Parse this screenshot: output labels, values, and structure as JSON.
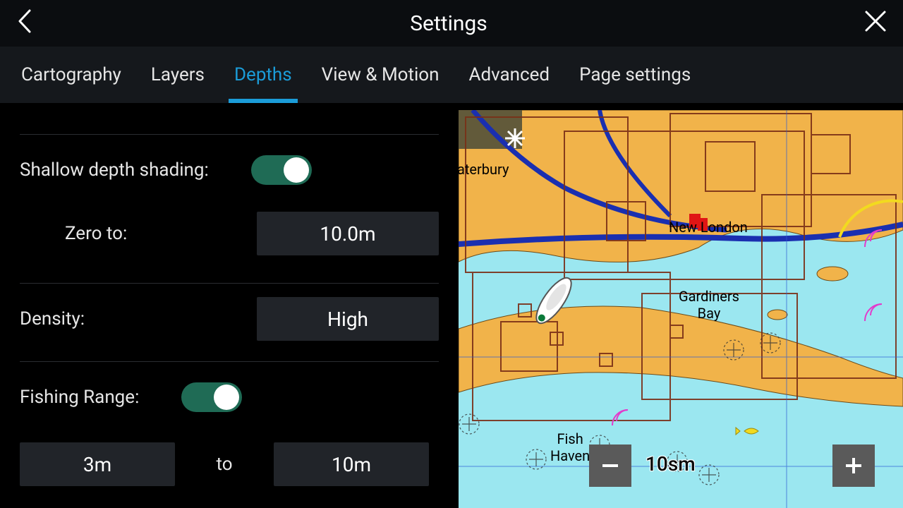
{
  "header": {
    "title": "Settings"
  },
  "tabs": [
    {
      "label": "Cartography"
    },
    {
      "label": "Layers"
    },
    {
      "label": "Depths",
      "active": true
    },
    {
      "label": "View & Motion"
    },
    {
      "label": "Advanced"
    },
    {
      "label": "Page settings"
    }
  ],
  "depths": {
    "shallow_shading": {
      "label": "Shallow depth shading:",
      "enabled": true,
      "zero_to_label": "Zero to:",
      "zero_to_value": "10.0m"
    },
    "density": {
      "label": "Density:",
      "value": "High"
    },
    "fishing_range": {
      "label": "Fishing Range:",
      "enabled": true,
      "from_value": "3m",
      "to_label": "to",
      "to_value": "10m"
    }
  },
  "map": {
    "scale_label": "10sm",
    "labels": {
      "aterbury": "aterbury",
      "new_london": "New London",
      "gardiners_bay": "Gardiners\nBay",
      "fish_haven": "Fish\nHaven"
    }
  }
}
